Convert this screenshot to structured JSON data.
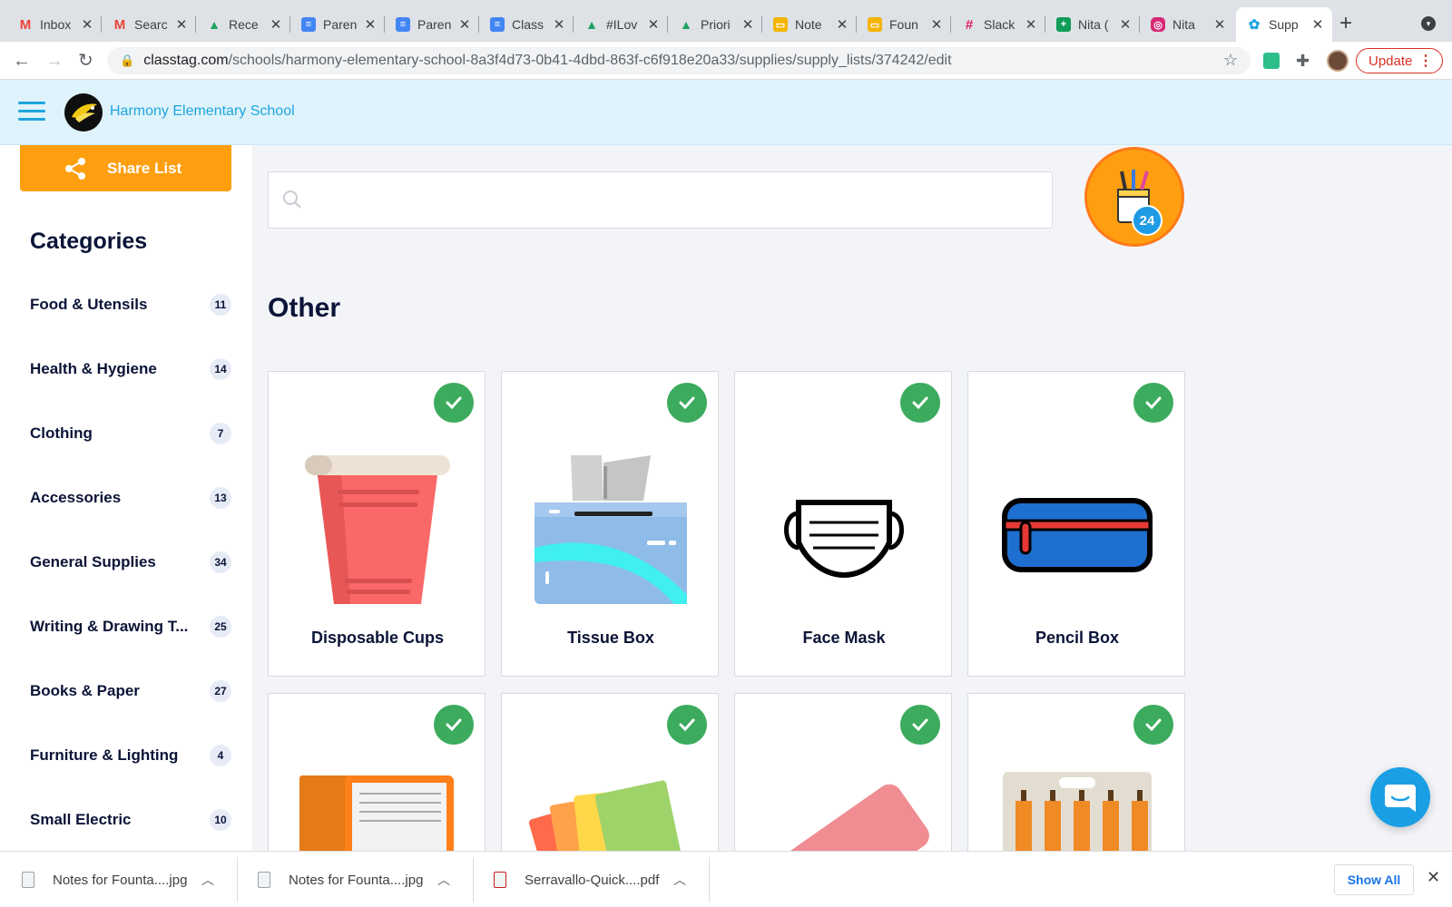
{
  "browser": {
    "tabs": [
      {
        "label": "Inbox",
        "icon": "gmail-icon",
        "color": "#ea4335",
        "glyph": "M"
      },
      {
        "label": "Searc",
        "icon": "gmail-icon",
        "color": "#ea4335",
        "glyph": "M"
      },
      {
        "label": "Rece",
        "icon": "google-drive-icon",
        "color": "#1fa463",
        "glyph": "▲"
      },
      {
        "label": "Paren",
        "icon": "google-docs-icon",
        "color": "#4285f4",
        "glyph": "≡"
      },
      {
        "label": "Paren",
        "icon": "google-docs-icon",
        "color": "#4285f4",
        "glyph": "≡"
      },
      {
        "label": "Class",
        "icon": "google-docs-icon",
        "color": "#4285f4",
        "glyph": "≡"
      },
      {
        "label": "#ILov",
        "icon": "google-drive-icon",
        "color": "#1fa463",
        "glyph": "▲"
      },
      {
        "label": "Priori",
        "icon": "google-drive-icon",
        "color": "#1fa463",
        "glyph": "▲"
      },
      {
        "label": "Note",
        "icon": "google-slides-icon",
        "color": "#f4b400",
        "glyph": "▭"
      },
      {
        "label": "Foun",
        "icon": "google-slides-icon",
        "color": "#f4b400",
        "glyph": "▭"
      },
      {
        "label": "Slack",
        "icon": "slack-icon",
        "color": "#611f69",
        "glyph": "#"
      },
      {
        "label": "Nita (",
        "icon": "google-sheets-icon",
        "color": "#0f9d58",
        "glyph": "+"
      },
      {
        "label": "Nita",
        "icon": "instagram-icon",
        "color": "#d62976",
        "glyph": "◎"
      },
      {
        "label": "Supp",
        "icon": "classtag-icon",
        "color": "#1ea5e0",
        "glyph": "✿"
      }
    ],
    "url_host": "classtag.com",
    "url_path": "/schools/harmony-elementary-school-8a3f4d73-0b41-4dbd-863f-c6f918e20a33/supplies/supply_lists/374242/edit",
    "update_label": "Update"
  },
  "header": {
    "school_name": "Harmony Elementary School"
  },
  "sidebar": {
    "share_label": "Share List",
    "categories_title": "Categories",
    "categories": [
      {
        "label": "Food & Utensils",
        "count": "11"
      },
      {
        "label": "Health & Hygiene",
        "count": "14"
      },
      {
        "label": "Clothing",
        "count": "7"
      },
      {
        "label": "Accessories",
        "count": "13"
      },
      {
        "label": "General Supplies",
        "count": "34"
      },
      {
        "label": "Writing & Drawing T...",
        "count": "25"
      },
      {
        "label": "Books & Paper",
        "count": "27"
      },
      {
        "label": "Furniture & Lighting",
        "count": "4"
      },
      {
        "label": "Small Electric",
        "count": "10"
      }
    ]
  },
  "main": {
    "search_placeholder": "",
    "cart_count": "24",
    "section_title": "Other",
    "items": [
      {
        "name": "Disposable Cups",
        "selected": true
      },
      {
        "name": "Tissue Box",
        "selected": true
      },
      {
        "name": "Face Mask",
        "selected": true
      },
      {
        "name": "Pencil Box",
        "selected": true
      },
      {
        "name": "",
        "selected": true
      },
      {
        "name": "",
        "selected": true
      },
      {
        "name": "",
        "selected": true
      },
      {
        "name": "",
        "selected": true
      }
    ]
  },
  "downloads": {
    "files": [
      "Notes for Founta....jpg",
      "Notes for Founta....jpg",
      "Serravallo-Quick....pdf"
    ],
    "show_all_label": "Show All"
  },
  "colors": {
    "accent_orange": "#ff9f0f",
    "brand_blue": "#1ea5e0",
    "check_green": "#3cab5d",
    "navy_text": "#0b1437"
  }
}
